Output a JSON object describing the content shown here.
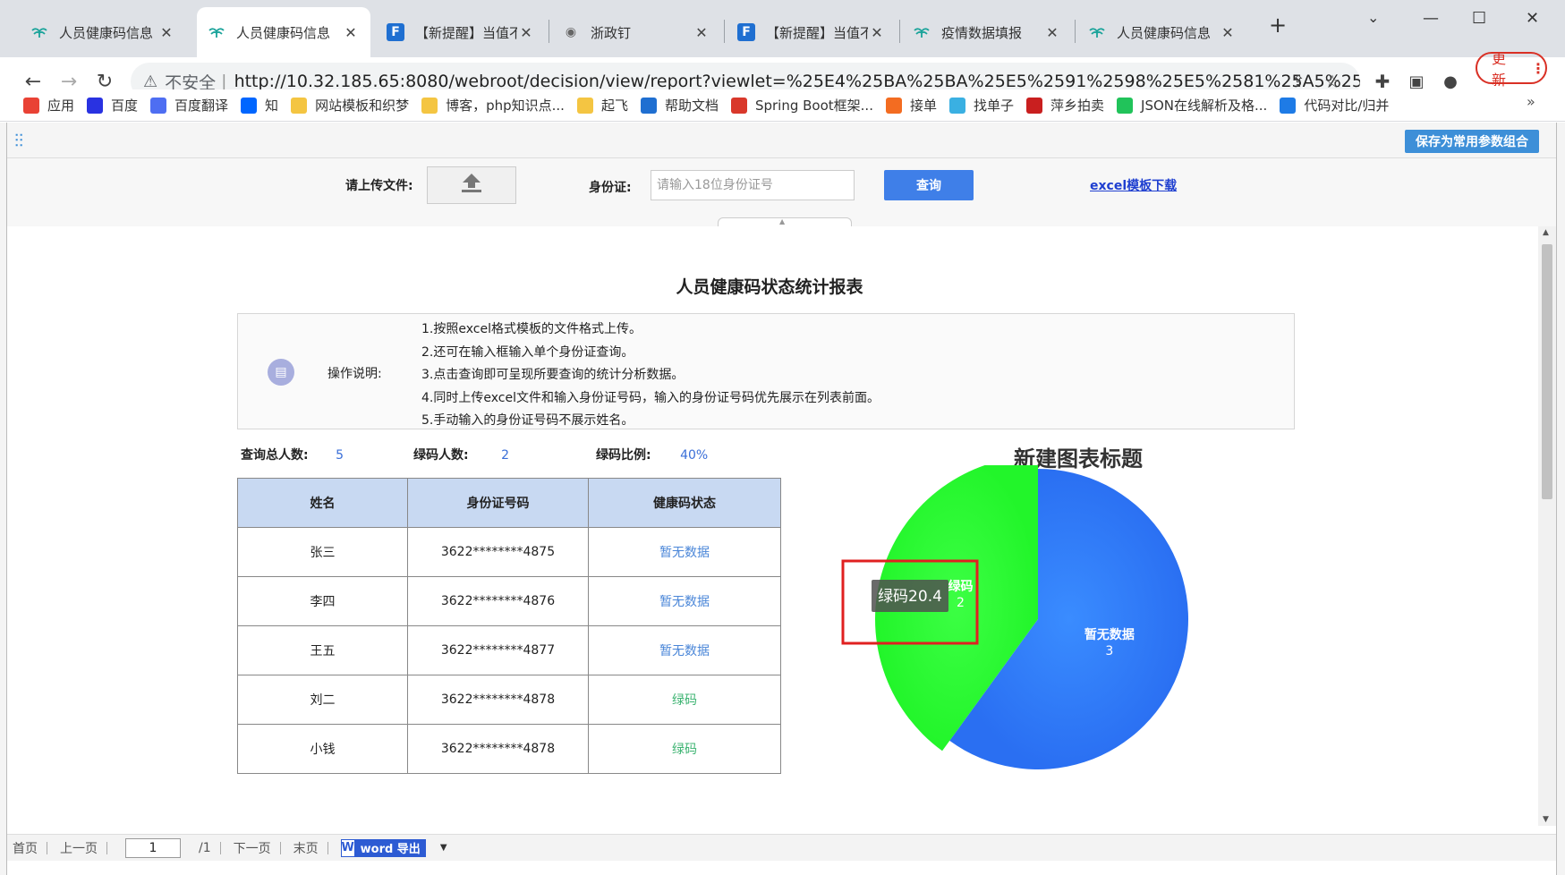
{
  "browser": {
    "tabs": [
      {
        "title": "人员健康码信息",
        "icon": "leaf-icon",
        "active": false
      },
      {
        "title": "人员健康码信息",
        "icon": "leaf-icon",
        "active": true
      },
      {
        "title": "【新提醒】当值不",
        "icon": "fanruan-icon",
        "active": false
      },
      {
        "title": "浙政钉",
        "icon": "globe-icon",
        "active": false
      },
      {
        "title": "【新提醒】当值不",
        "icon": "fanruan-icon",
        "active": false
      },
      {
        "title": "疫情数据填报",
        "icon": "leaf-icon",
        "active": false
      },
      {
        "title": "人员健康码信息",
        "icon": "leaf-icon",
        "active": false
      }
    ],
    "security_label": "不安全",
    "url": "http://10.32.185.65:8080/webroot/decision/view/report?viewlet=%25E4%25BA%25BA%25E5%2591%2598%25E5%2581%25A5%25E5%25...",
    "update_label": "更新",
    "bookmarks": [
      {
        "label": "应用",
        "icon": "apps-grid-icon",
        "color": "#e94235"
      },
      {
        "label": "百度",
        "icon": "baidu-paw-icon",
        "color": "#2932e1"
      },
      {
        "label": "百度翻译",
        "icon": "translate-icon",
        "color": "#4e6ef2"
      },
      {
        "label": "知",
        "icon": "zhihu-icon",
        "color": "#0066ff"
      },
      {
        "label": "网站模板和织梦",
        "icon": "folder-icon",
        "color": "#f4c542"
      },
      {
        "label": "博客，php知识点...",
        "icon": "folder-icon",
        "color": "#f4c542"
      },
      {
        "label": "起飞",
        "icon": "folder-icon",
        "color": "#f4c542"
      },
      {
        "label": "帮助文档",
        "icon": "fanruan-icon",
        "color": "#1f6fd1"
      },
      {
        "label": "Spring Boot框架...",
        "icon": "csdn-icon",
        "color": "#d9382b"
      },
      {
        "label": "接单",
        "icon": "orange-circle-icon",
        "color": "#f36c21"
      },
      {
        "label": "找单子",
        "icon": "grid-icon",
        "color": "#3ab0e2"
      },
      {
        "label": "萍乡拍卖",
        "icon": "gavel-icon",
        "color": "#c91f1f"
      },
      {
        "label": "JSON在线解析及格...",
        "icon": "json-icon",
        "color": "#21c35a"
      },
      {
        "label": "代码对比/归并",
        "icon": "compare-icon",
        "color": "#1e7be6"
      }
    ]
  },
  "report_toolbar": {
    "save_params_label": "保存为常用参数组合"
  },
  "params": {
    "upload_label": "请上传文件:",
    "id_label": "身份证:",
    "id_placeholder": "请输入18位身份证号",
    "query_label": "查询",
    "template_download_label": "excel模板下载"
  },
  "report": {
    "title": "人员健康码状态统计报表",
    "instructions_label": "操作说明:",
    "instructions": [
      "1.按照excel格式模板的文件格式上传。",
      "2.还可在输入框输入单个身份证查询。",
      "3.点击查询即可呈现所要查询的统计分析数据。",
      "4.同时上传excel文件和输入身份证号码，输入的身份证号码优先展示在列表前面。",
      "5.手动输入的身份证号码不展示姓名。"
    ],
    "stats": {
      "total_label": "查询总人数:",
      "total_value": "5",
      "green_label": "绿码人数:",
      "green_value": "2",
      "ratio_label": "绿码比例:",
      "ratio_value": "40%"
    },
    "table": {
      "headers": [
        "姓名",
        "身份证号码",
        "健康码状态"
      ],
      "rows": [
        {
          "name": "张三",
          "id": "3622********4875",
          "status": "暂无数据",
          "kind": "none"
        },
        {
          "name": "李四",
          "id": "3622********4876",
          "status": "暂无数据",
          "kind": "none"
        },
        {
          "name": "王五",
          "id": "3622********4877",
          "status": "暂无数据",
          "kind": "none"
        },
        {
          "name": "刘二",
          "id": "3622********4878",
          "status": "绿码",
          "kind": "green"
        },
        {
          "name": "小钱",
          "id": "3622********4878",
          "status": "绿码",
          "kind": "green"
        }
      ]
    }
  },
  "chart_data": {
    "type": "pie",
    "title": "新建图表标题",
    "slices": [
      {
        "label": "暂无数据",
        "value": 3,
        "color": "#2a6ff2"
      },
      {
        "label": "绿码",
        "value": 2,
        "color": "#22f52a",
        "exploded": true
      }
    ],
    "tooltip": "绿码20.4"
  },
  "pager": {
    "first": "首页",
    "prev": "上一页",
    "page": "1",
    "total": "/1",
    "next": "下一页",
    "last": "末页",
    "word_export": "word 导出"
  }
}
